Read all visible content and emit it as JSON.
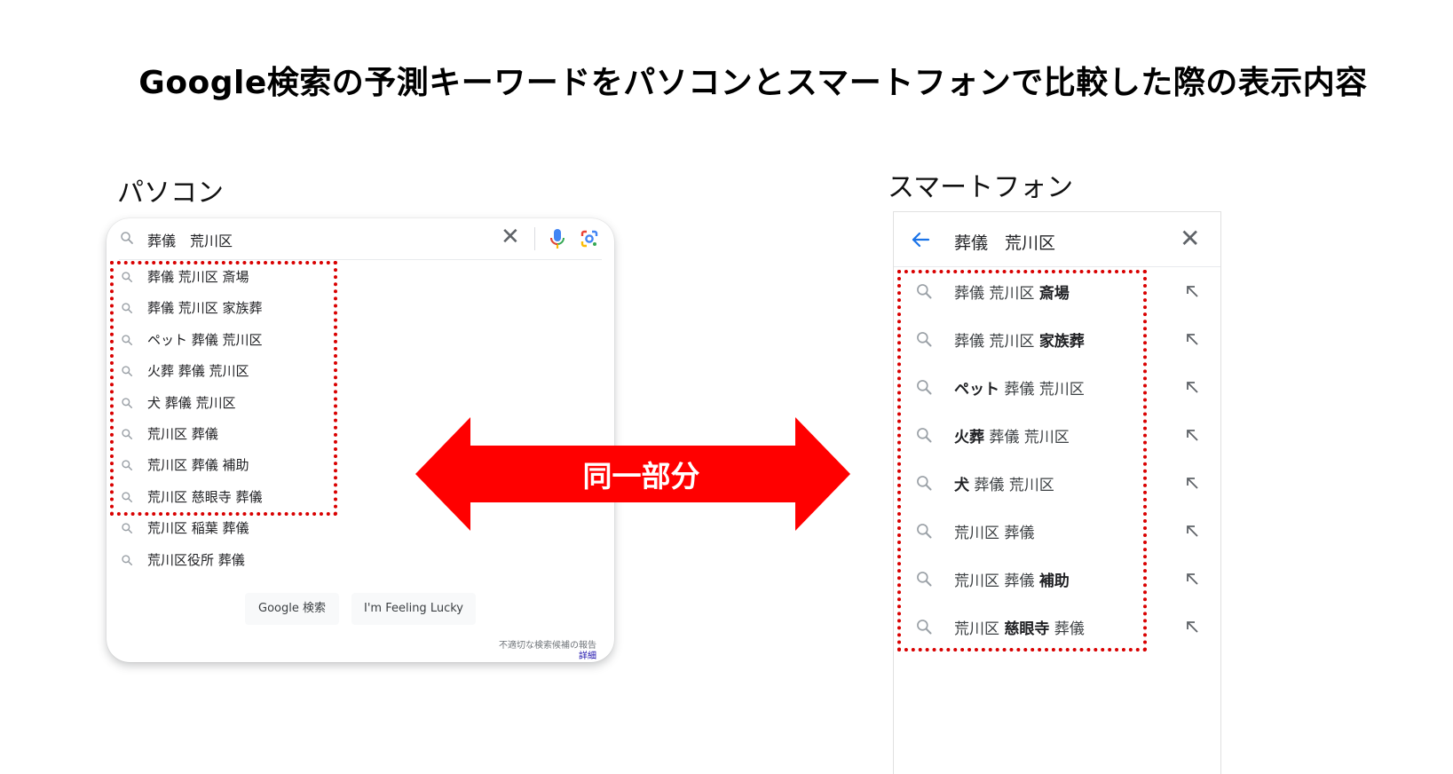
{
  "title": "Google検索の予測キーワードをパソコンとスマートフォンで比較した際の表示内容",
  "pc": {
    "label": "パソコン",
    "query": "葬儀　荒川区",
    "clear_symbol": "✕",
    "suggestions": [
      "葬儀 荒川区 斎場",
      "葬儀 荒川区 家族葬",
      "ペット 葬儀 荒川区",
      "火葬 葬儀 荒川区",
      "犬 葬儀 荒川区",
      "荒川区 葬儀",
      "荒川区 葬儀 補助",
      "荒川区 慈眼寺 葬儀",
      "荒川区 稲葉 葬儀",
      "荒川区役所 葬儀"
    ],
    "search_button": "Google 検索",
    "lucky_button": "I'm Feeling Lucky",
    "report_text": "不適切な検索候補の報告",
    "details_link": "詳細"
  },
  "arrow": {
    "label": "同一部分",
    "color": "#ff0000"
  },
  "sp": {
    "label": "スマートフォン",
    "query": "葬儀　荒川区",
    "clear_symbol": "✕",
    "suggestions": [
      {
        "normal_before": "葬儀 荒川区 ",
        "bold": "斎場",
        "normal_after": ""
      },
      {
        "normal_before": "葬儀 荒川区 ",
        "bold": "家族葬",
        "normal_after": ""
      },
      {
        "normal_before": "",
        "bold": "ペット",
        "normal_after": " 葬儀 荒川区"
      },
      {
        "normal_before": "",
        "bold": "火葬",
        "normal_after": " 葬儀 荒川区"
      },
      {
        "normal_before": "",
        "bold": "犬",
        "normal_after": " 葬儀 荒川区"
      },
      {
        "normal_before": "荒川区 葬儀",
        "bold": "",
        "normal_after": ""
      },
      {
        "normal_before": "荒川区 葬儀 ",
        "bold": "補助",
        "normal_after": ""
      },
      {
        "normal_before": "荒川区 ",
        "bold": "慈眼寺",
        "normal_after": " 葬儀"
      }
    ]
  },
  "colors": {
    "highlight": "#d90000",
    "accent_blue": "#1a73e8",
    "icon_gray": "#9aa0a6"
  }
}
